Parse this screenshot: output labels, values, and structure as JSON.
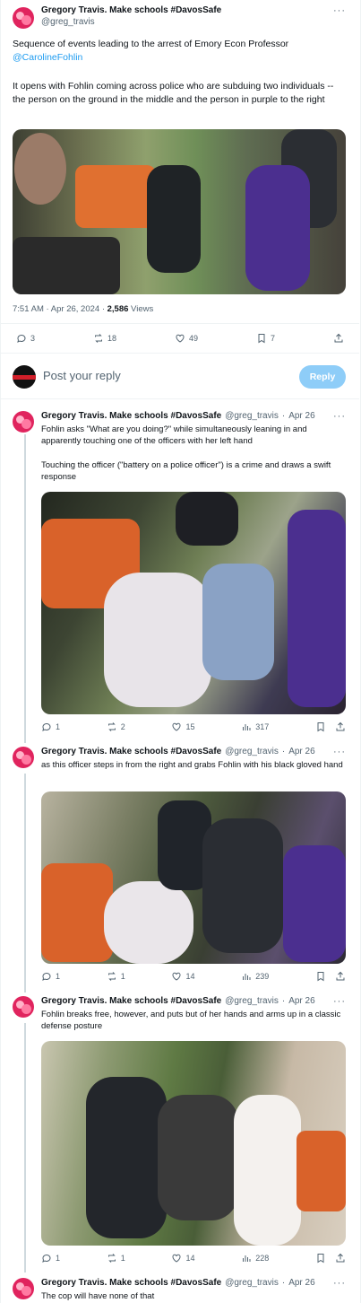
{
  "main": {
    "name": "Gregory Travis. Make schools #DavosSafe",
    "handle": "@greg_travis",
    "text_line1": "Sequence of events leading to the arrest of Emory Econ Professor",
    "mention": "@CarolineFohlin",
    "text_line2": "It opens with Fohlin coming across police who are subduing two individuals -- the person on the ground in the middle and the person in purple to the right",
    "time": "7:51 AM · Apr 26, 2024 · ",
    "views_count": "2,586",
    "views_label": " Views",
    "replies": "3",
    "reposts": "18",
    "likes": "49",
    "bookmarks": "7"
  },
  "reply_bar": {
    "placeholder": "Post your reply",
    "button": "Reply"
  },
  "thread": [
    {
      "name": "Gregory Travis. Make schools #DavosSafe",
      "handle": "@greg_travis",
      "dot": "·",
      "date": "Apr 26",
      "text1": "Fohlin asks \"What are you doing?\" while simultaneously leaning in and apparently touching one of the officers with her left hand",
      "text2": "Touching the officer (\"battery on a police officer\") is a crime and draws a swift response",
      "replies": "1",
      "reposts": "2",
      "likes": "15",
      "views": "317"
    },
    {
      "name": "Gregory Travis. Make schools #DavosSafe",
      "handle": "@greg_travis",
      "dot": "·",
      "date": "Apr 26",
      "text1": "as this officer steps in from the right and grabs Fohlin with his black gloved hand",
      "replies": "1",
      "reposts": "1",
      "likes": "14",
      "views": "239"
    },
    {
      "name": "Gregory Travis. Make schools #DavosSafe",
      "handle": "@greg_travis",
      "dot": "·",
      "date": "Apr 26",
      "text1": "Fohlin breaks free, however, and puts but of her hands and arms up in a classic defense posture",
      "replies": "1",
      "reposts": "1",
      "likes": "14",
      "views": "228"
    },
    {
      "name": "Gregory Travis. Make schools #DavosSafe",
      "handle": "@greg_travis",
      "dot": "·",
      "date": "Apr 26",
      "text1": "The cop will have none of that"
    }
  ],
  "icons": {
    "more": "more-icon",
    "reply": "reply-icon",
    "repost": "repost-icon",
    "like": "like-icon",
    "bookmark": "bookmark-icon",
    "share": "share-icon",
    "views": "views-icon"
  },
  "colors": {
    "accent": "#1d9bf0",
    "avatar": "#e0245e",
    "muted": "#536471"
  }
}
